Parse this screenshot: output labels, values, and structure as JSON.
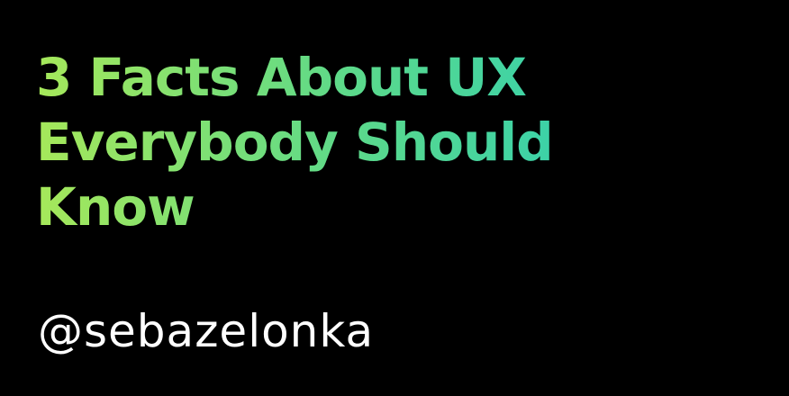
{
  "title": {
    "lines": [
      "3 Facts About UX",
      "Everybody Should",
      "Know"
    ]
  },
  "handle": "@sebazelonka",
  "colors": {
    "background": "#000000",
    "gradient_start": "#a6e85a",
    "gradient_end": "#33d0b0",
    "handle_text": "#ffffff"
  }
}
